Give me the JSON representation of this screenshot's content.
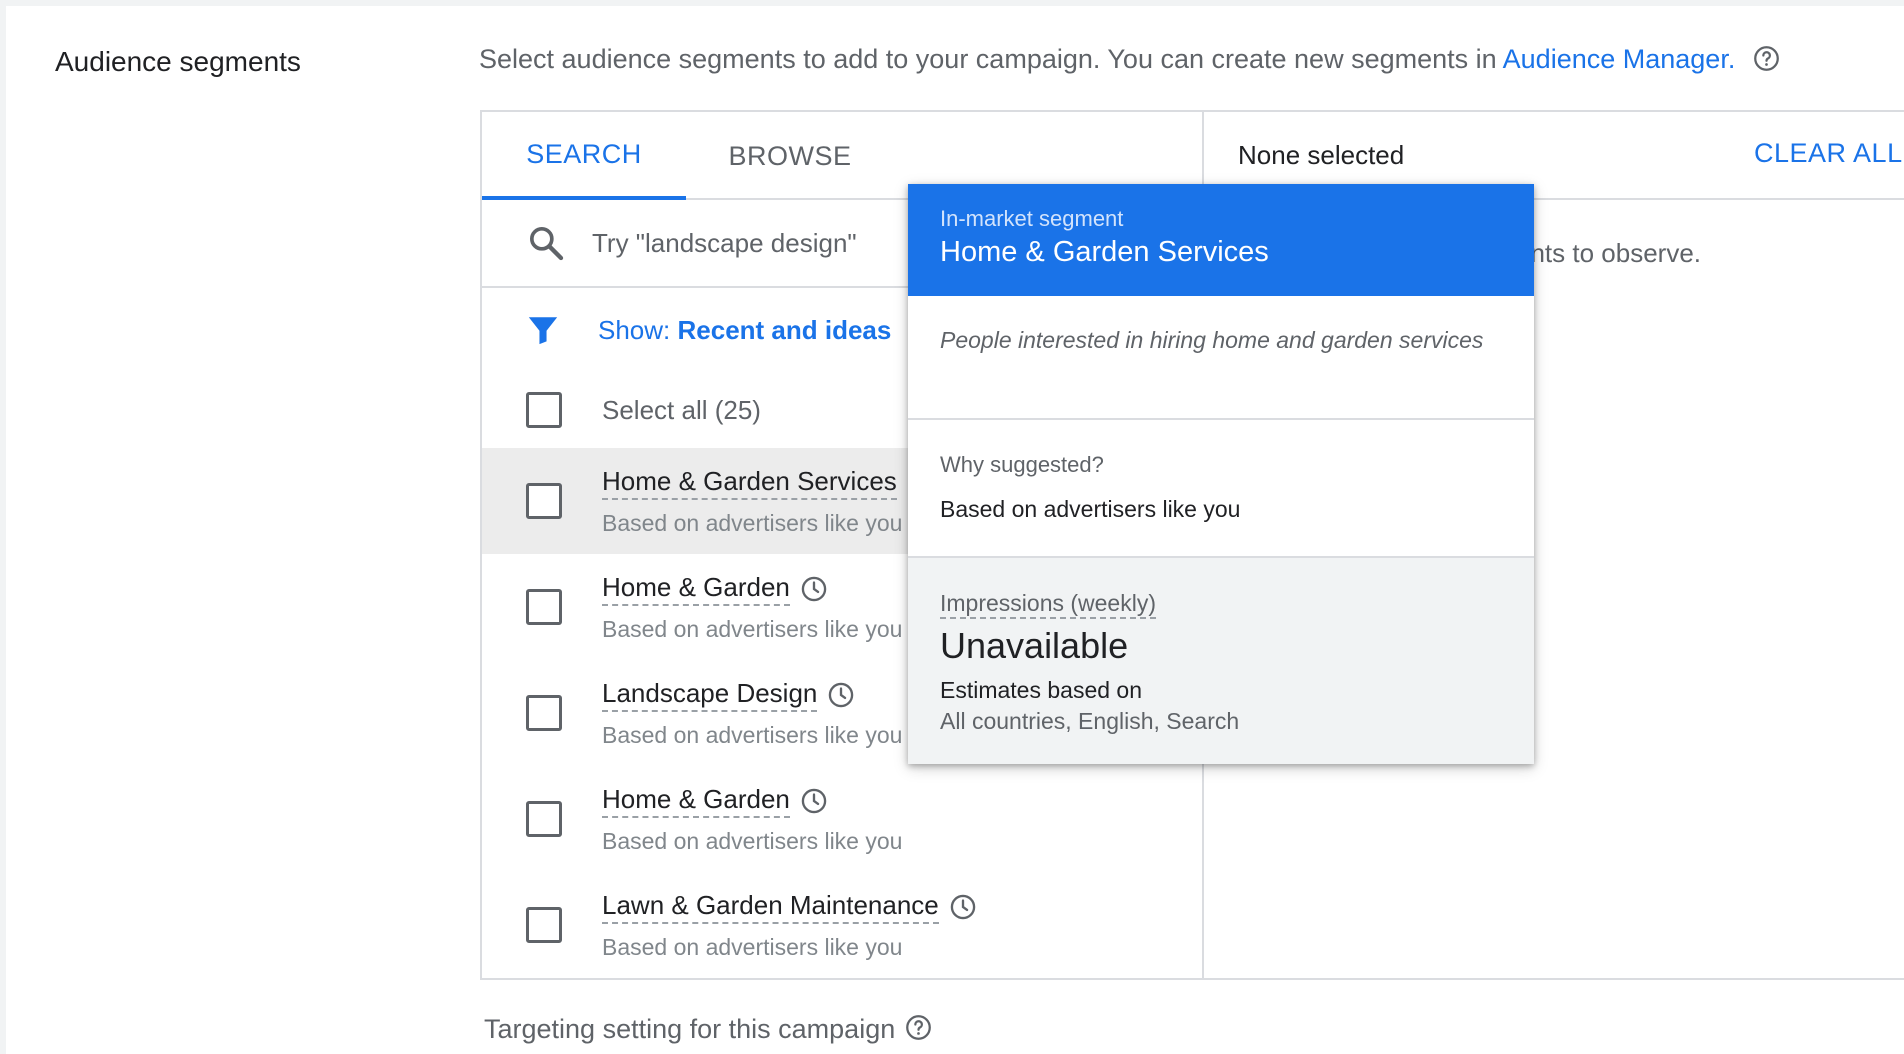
{
  "section": {
    "label": "Audience segments",
    "intro_text": "Select audience segments to add to your campaign. You can create new segments in ",
    "intro_link": "Audience Manager."
  },
  "tabs": [
    {
      "label": "SEARCH",
      "active": true
    },
    {
      "label": "BROWSE",
      "active": false
    }
  ],
  "search": {
    "placeholder": "Try \"landscape design\""
  },
  "filter": {
    "prefix": "Show: ",
    "value": "Recent and ideas"
  },
  "select_all": {
    "label": "Select all (25)"
  },
  "items": [
    {
      "title": "Home & Garden Services",
      "sub": "Based on advertisers like you"
    },
    {
      "title": "Home & Garden",
      "sub": "Based on advertisers like you"
    },
    {
      "title": "Landscape Design",
      "sub": "Based on advertisers like you"
    },
    {
      "title": "Home & Garden",
      "sub": "Based on advertisers like you"
    },
    {
      "title": "Lawn & Garden Maintenance",
      "sub": "Based on advertisers like you"
    }
  ],
  "right_panel": {
    "status": "None selected",
    "clear_all": "CLEAR ALL",
    "observe_text": "ents to observe."
  },
  "popover": {
    "type": "In-market segment",
    "name": "Home & Garden Services",
    "description": "People interested in hiring home and garden services",
    "why_label": "Why suggested?",
    "why_value": "Based on advertisers like you",
    "impressions_label": "Impressions (weekly)",
    "impressions_value": "Unavailable",
    "estimates_label": "Estimates based on",
    "estimates_value": "All countries, English, Search"
  },
  "targeting": {
    "label": "Targeting setting for this campaign"
  },
  "colors": {
    "accent": "#1a73e8",
    "hover_row": "#ececec",
    "popover_footer": "#f1f3f4"
  }
}
